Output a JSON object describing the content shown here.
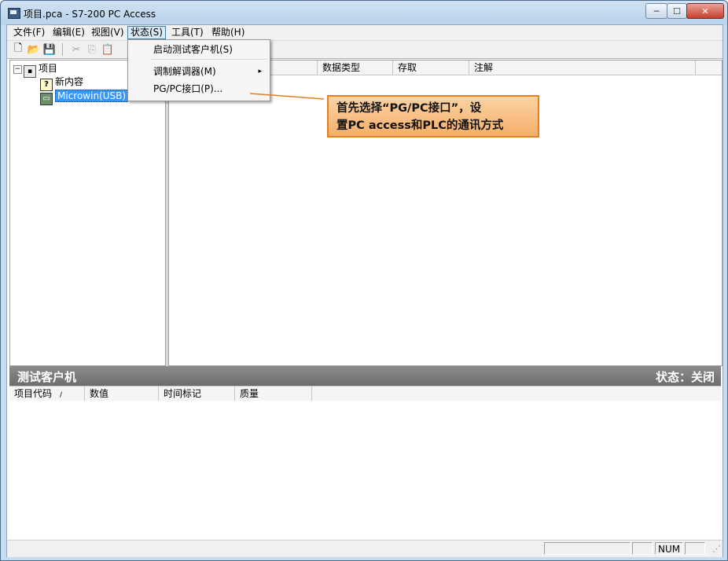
{
  "window": {
    "title": "项目.pca - S7-200 PC Access",
    "min_glyph": "─",
    "max_glyph": "☐",
    "close_glyph": "✕"
  },
  "menubar": {
    "items": [
      "文件(F)",
      "编辑(E)",
      "视图(V)",
      "状态(S)",
      "工具(T)",
      "帮助(H)"
    ],
    "active_index": 3
  },
  "toolbar": {
    "icons": [
      "new-file-icon",
      "open-folder-icon",
      "save-icon",
      "cut-icon",
      "copy-icon",
      "paste-icon"
    ],
    "glyphs": [
      "🗋",
      "📂",
      "💾",
      "✂",
      "⎘",
      "📋"
    ]
  },
  "tree": {
    "root_label": "项目",
    "child_label": "新内容",
    "selected_label": "Microwin(USB)",
    "expander": "−",
    "unknown_glyph": "?"
  },
  "list": {
    "columns": [
      "",
      "数据类型",
      "存取",
      "注解"
    ]
  },
  "status_menu": {
    "items": [
      "启动测试客户机(S)",
      "调制解调器(M)",
      "PG/PC接口(P)..."
    ],
    "submenu_arrow": "▸"
  },
  "callout": {
    "line1": "首先选择“PG/PC接口”，设",
    "line2": "置PC access和PLC的通讯方式",
    "border_color": "#e67e22"
  },
  "test_client": {
    "title": "测试客户机",
    "status": "状态：关闭",
    "columns": [
      "项目代码",
      "数值",
      "时间标记",
      "质量"
    ],
    "sort_indicator": "/"
  },
  "statusbar": {
    "num_label": "NUM"
  }
}
